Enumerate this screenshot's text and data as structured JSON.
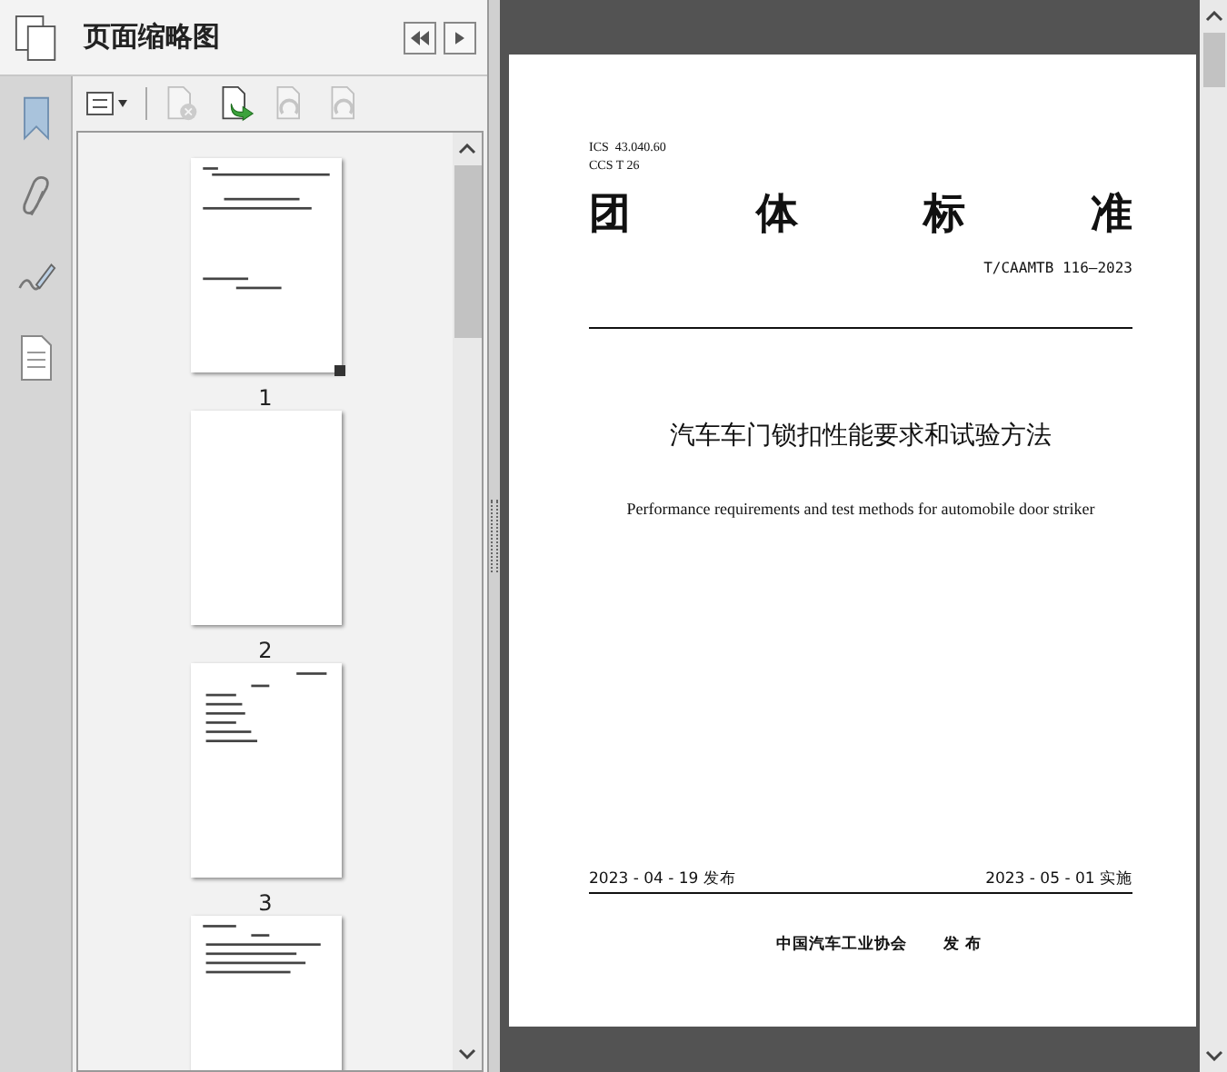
{
  "panel": {
    "title": "页面缩略图"
  },
  "toolbar": [
    {
      "kind": "options",
      "disabled": false
    },
    {
      "kind": "delete",
      "disabled": true
    },
    {
      "kind": "insert",
      "disabled": false
    },
    {
      "kind": "rotate-left",
      "disabled": true
    },
    {
      "kind": "rotate-right",
      "disabled": true
    }
  ],
  "thumbnails": [
    {
      "label": "1",
      "kind": "cover",
      "current": true
    },
    {
      "label": "2",
      "kind": "blank",
      "current": false
    },
    {
      "label": "3",
      "kind": "contents",
      "current": false
    },
    {
      "kind": "text",
      "current": false
    }
  ],
  "document": {
    "ics": "ICS  43.040.60",
    "ccs": "CCS T 26",
    "heading": "团 体 标 准",
    "number": "T/CAAMTB 116—2023",
    "title": "汽车车门锁扣性能要求和试验方法",
    "english_title": "Performance requirements and test methods for automobile door striker",
    "issued": "2023 - 04 - 19 发布",
    "effective": "2023 - 05 - 01 实施",
    "publisher": "中国汽车工业协会",
    "publisher_action": "发 布"
  }
}
